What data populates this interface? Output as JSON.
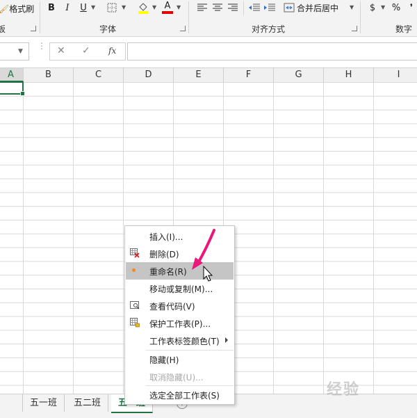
{
  "ribbon": {
    "format_painter": "格式刷",
    "group_left_partial": "板",
    "bold": "B",
    "italic": "I",
    "underline": "U",
    "font_color_letter": "A",
    "group_font": "字体",
    "merge_center": "合并后居中",
    "group_align": "对齐方式",
    "currency": "$",
    "percent": "%",
    "group_number": "数字"
  },
  "formula_bar": {
    "fx": "fx"
  },
  "columns": [
    "A",
    "B",
    "C",
    "D",
    "E",
    "F",
    "G",
    "H",
    "I"
  ],
  "sheet_tabs": [
    "五一班",
    "五二班",
    "五一班"
  ],
  "context_menu": {
    "items": [
      {
        "label": "插入(I)..."
      },
      {
        "label": "删除(D)"
      },
      {
        "label": "重命名(R)"
      },
      {
        "label": "移动或复制(M)..."
      },
      {
        "label": "查看代码(V)"
      },
      {
        "label": "保护工作表(P)..."
      },
      {
        "label": "工作表标签颜色(T)"
      },
      {
        "label": "隐藏(H)"
      },
      {
        "label": "取消隐藏(U)..."
      },
      {
        "label": "选定全部工作表(S)"
      }
    ]
  },
  "watermark": "经验",
  "colors": {
    "excel_green": "#217346",
    "arrow_pink": "#e8197a",
    "bullet_orange": "#f08a24"
  }
}
